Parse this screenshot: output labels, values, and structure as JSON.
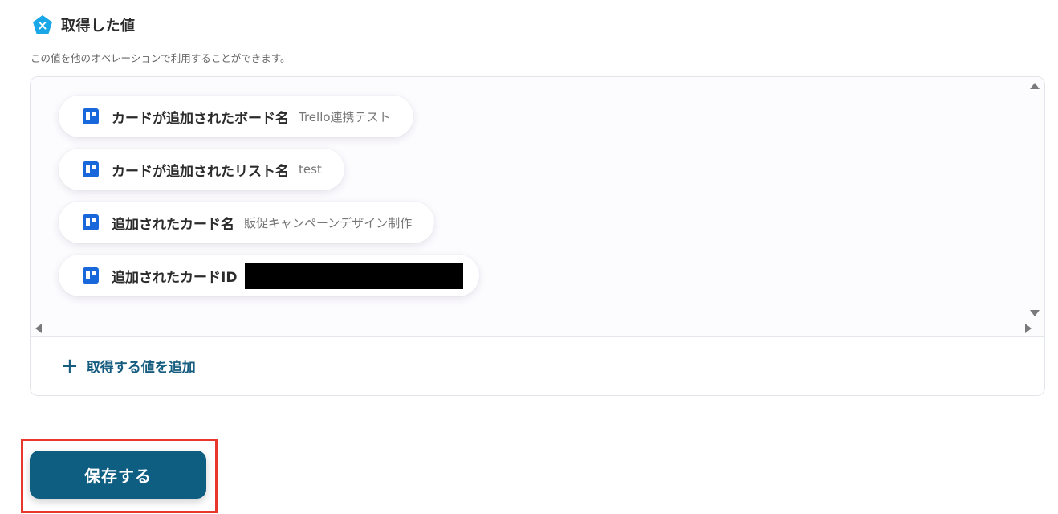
{
  "section": {
    "title": "取得した値",
    "description": "この値を他のオペレーションで利用することができます。",
    "icon": "yoom-pentagon-x-icon",
    "icon_color": "#1aa7e8"
  },
  "values": [
    {
      "label": "カードが追加されたボード名",
      "value": "Trello連携テスト",
      "icon": "trello-icon"
    },
    {
      "label": "カードが追加されたリスト名",
      "value": "test",
      "icon": "trello-icon"
    },
    {
      "label": "追加されたカード名",
      "value": "販促キャンペーンデザイン制作",
      "icon": "trello-icon"
    },
    {
      "label": "追加されたカードID",
      "value": "",
      "redacted": true,
      "icon": "trello-icon"
    }
  ],
  "add_value": {
    "label": "取得する値を追加",
    "icon": "plus-icon"
  },
  "save_button": {
    "label": "保存する",
    "color": "#0e5e82"
  },
  "highlight_color": "#e8382c",
  "trello_color": "#1868db"
}
